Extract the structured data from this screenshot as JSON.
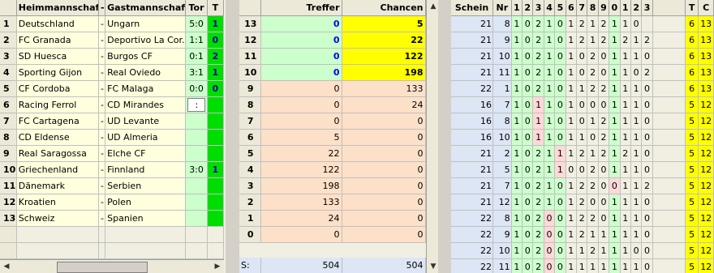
{
  "left": {
    "headers": [
      "Heimmannschaft",
      "-",
      "Gastmannschaft",
      "Tor",
      "T"
    ],
    "rows": [
      {
        "nr": "1",
        "home": "Deutschland",
        "sep": "-",
        "away": "Ungarn",
        "tor": "5:0",
        "t": "1"
      },
      {
        "nr": "2",
        "home": "FC Granada",
        "sep": "-",
        "away": "Deportivo La Cor...",
        "tor": "1:1",
        "t": "0"
      },
      {
        "nr": "3",
        "home": "SD Huesca",
        "sep": "-",
        "away": "Burgos CF",
        "tor": "0:1",
        "t": "2"
      },
      {
        "nr": "4",
        "home": "Sporting Gijon",
        "sep": "-",
        "away": "Real Oviedo",
        "tor": "3:1",
        "t": "1"
      },
      {
        "nr": "5",
        "home": "CF Cordoba",
        "sep": "-",
        "away": "FC Malaga",
        "tor": "0:0",
        "t": "0"
      },
      {
        "nr": "6",
        "home": "Racing Ferrol",
        "sep": "-",
        "away": "CD Mirandes",
        "tor": ":",
        "t": ""
      },
      {
        "nr": "7",
        "home": "FC Cartagena",
        "sep": "-",
        "away": "UD Levante",
        "tor": "",
        "t": ""
      },
      {
        "nr": "8",
        "home": "CD Eldense",
        "sep": "-",
        "away": "UD Almeria",
        "tor": "",
        "t": ""
      },
      {
        "nr": "9",
        "home": "Real Saragossa",
        "sep": "-",
        "away": "Elche CF",
        "tor": "",
        "t": ""
      },
      {
        "nr": "10",
        "home": "Griechenland",
        "sep": "-",
        "away": "Finnland",
        "tor": "3:0",
        "t": "1"
      },
      {
        "nr": "11",
        "home": "Dänemark",
        "sep": "-",
        "away": "Serbien",
        "tor": "",
        "t": ""
      },
      {
        "nr": "12",
        "home": "Kroatien",
        "sep": "-",
        "away": "Polen",
        "tor": "",
        "t": ""
      },
      {
        "nr": "13",
        "home": "Schweiz",
        "sep": "-",
        "away": "Spanien",
        "tor": "",
        "t": ""
      }
    ]
  },
  "middle": {
    "headers": [
      "",
      "Treffer",
      "Chancen"
    ],
    "rows": [
      {
        "k": "13",
        "treffer": "0",
        "chancen": "5",
        "top": true
      },
      {
        "k": "12",
        "treffer": "0",
        "chancen": "22",
        "top": true
      },
      {
        "k": "11",
        "treffer": "0",
        "chancen": "122",
        "top": true
      },
      {
        "k": "10",
        "treffer": "0",
        "chancen": "198",
        "top": true
      },
      {
        "k": "9",
        "treffer": "0",
        "chancen": "133",
        "top": false
      },
      {
        "k": "8",
        "treffer": "0",
        "chancen": "24",
        "top": false
      },
      {
        "k": "7",
        "treffer": "0",
        "chancen": "0",
        "top": false
      },
      {
        "k": "6",
        "treffer": "5",
        "chancen": "0",
        "top": false
      },
      {
        "k": "5",
        "treffer": "22",
        "chancen": "0",
        "top": false
      },
      {
        "k": "4",
        "treffer": "122",
        "chancen": "0",
        "top": false
      },
      {
        "k": "3",
        "treffer": "198",
        "chancen": "0",
        "top": false
      },
      {
        "k": "2",
        "treffer": "133",
        "chancen": "0",
        "top": false
      },
      {
        "k": "1",
        "treffer": "24",
        "chancen": "0",
        "top": false
      },
      {
        "k": "0",
        "treffer": "0",
        "chancen": "0",
        "top": false
      }
    ],
    "sum_label": "S:",
    "sum_treffer": "504",
    "sum_chancen": "504"
  },
  "right": {
    "headers": [
      "Schein",
      "Nr",
      "1",
      "2",
      "3",
      "4",
      "5",
      "6",
      "7",
      "8",
      "9",
      "0",
      "1",
      "2",
      "3",
      "",
      "T",
      "C"
    ],
    "rows": [
      [
        "21",
        "8",
        "1",
        "0",
        "2",
        "1",
        "0",
        "1",
        "2",
        "1",
        "2",
        "1",
        "1",
        "0",
        "",
        "",
        "6",
        "13"
      ],
      [
        "21",
        "9",
        "1",
        "0",
        "2",
        "1",
        "0",
        "1",
        "2",
        "1",
        "2",
        "1",
        "2",
        "1",
        "2",
        "",
        "6",
        "13"
      ],
      [
        "21",
        "10",
        "1",
        "0",
        "2",
        "1",
        "0",
        "1",
        "0",
        "2",
        "0",
        "1",
        "1",
        "1",
        "0",
        "",
        "6",
        "13"
      ],
      [
        "21",
        "11",
        "1",
        "0",
        "2",
        "1",
        "0",
        "1",
        "0",
        "2",
        "0",
        "1",
        "1",
        "0",
        "2",
        "",
        "6",
        "13"
      ],
      [
        "22",
        "1",
        "1",
        "0",
        "2",
        "1",
        "0",
        "1",
        "1",
        "2",
        "2",
        "1",
        "1",
        "1",
        "0",
        "",
        "6",
        "13"
      ],
      [
        "16",
        "7",
        "1",
        "0",
        "1",
        "1",
        "0",
        "1",
        "0",
        "0",
        "0",
        "1",
        "1",
        "1",
        "0",
        "",
        "5",
        "12"
      ],
      [
        "16",
        "8",
        "1",
        "0",
        "1",
        "1",
        "0",
        "1",
        "0",
        "1",
        "2",
        "1",
        "1",
        "1",
        "0",
        "",
        "5",
        "12"
      ],
      [
        "16",
        "10",
        "1",
        "0",
        "1",
        "1",
        "0",
        "1",
        "1",
        "0",
        "2",
        "1",
        "1",
        "1",
        "0",
        "",
        "5",
        "12"
      ],
      [
        "21",
        "2",
        "1",
        "0",
        "2",
        "1",
        "1",
        "1",
        "2",
        "1",
        "2",
        "1",
        "2",
        "1",
        "0",
        "",
        "5",
        "12"
      ],
      [
        "21",
        "5",
        "1",
        "0",
        "2",
        "1",
        "1",
        "0",
        "0",
        "2",
        "0",
        "1",
        "1",
        "1",
        "0",
        "",
        "5",
        "12"
      ],
      [
        "21",
        "7",
        "1",
        "0",
        "2",
        "1",
        "0",
        "1",
        "2",
        "2",
        "0",
        "0",
        "1",
        "1",
        "2",
        "",
        "5",
        "12"
      ],
      [
        "21",
        "12",
        "1",
        "0",
        "2",
        "1",
        "0",
        "1",
        "2",
        "0",
        "0",
        "1",
        "1",
        "1",
        "0",
        "",
        "5",
        "12"
      ],
      [
        "22",
        "8",
        "1",
        "0",
        "2",
        "0",
        "0",
        "1",
        "2",
        "2",
        "0",
        "1",
        "1",
        "1",
        "0",
        "",
        "5",
        "12"
      ],
      [
        "22",
        "9",
        "1",
        "0",
        "2",
        "0",
        "0",
        "1",
        "2",
        "1",
        "1",
        "1",
        "1",
        "1",
        "0",
        "",
        "5",
        "12"
      ],
      [
        "22",
        "10",
        "1",
        "0",
        "2",
        "0",
        "0",
        "1",
        "1",
        "2",
        "1",
        "1",
        "1",
        "0",
        "0",
        "",
        "5",
        "12"
      ],
      [
        "22",
        "11",
        "1",
        "0",
        "2",
        "0",
        "0",
        "1",
        "1",
        "1",
        "1",
        "1",
        "1",
        "1",
        "0",
        "",
        "5",
        "12"
      ]
    ]
  }
}
